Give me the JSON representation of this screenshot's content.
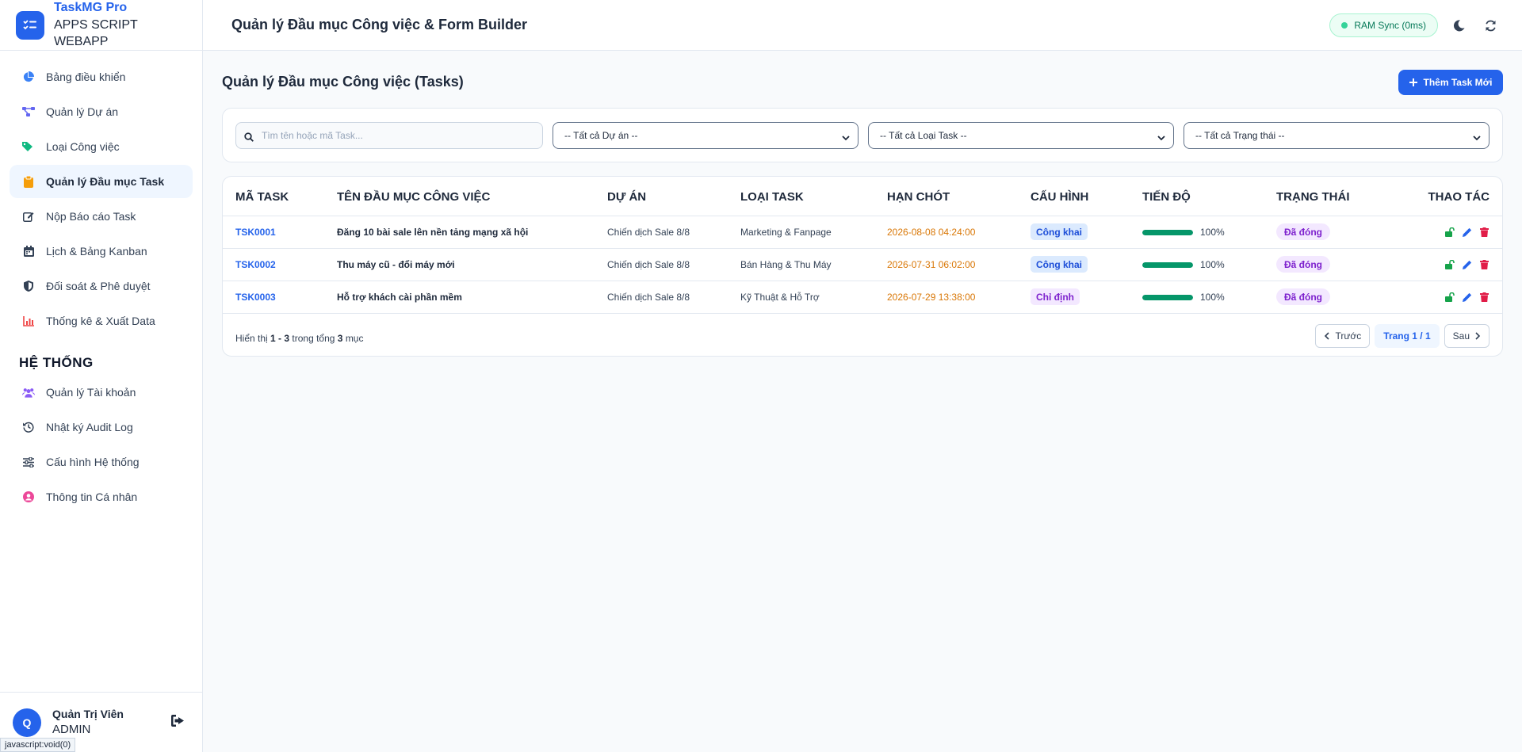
{
  "brand": {
    "name": "TaskMG Pro",
    "subtitle": "APPS SCRIPT WEBAPP"
  },
  "sidebar": {
    "items": [
      {
        "label": "Bảng điều khiển",
        "icon": "pie-chart-icon",
        "color": "#3b82f6",
        "active": false
      },
      {
        "label": "Quản lý Dự án",
        "icon": "project-diagram-icon",
        "color": "#6366f1",
        "active": false
      },
      {
        "label": "Loại Công việc",
        "icon": "tags-icon",
        "color": "#10b981",
        "active": false
      },
      {
        "label": "Quản lý Đầu mục Task",
        "icon": "clipboard-icon",
        "color": "#f59e0b",
        "active": true
      },
      {
        "label": "Nộp Báo cáo Task",
        "icon": "edit-icon",
        "color": "#334155",
        "active": false
      },
      {
        "label": "Lịch & Bảng Kanban",
        "icon": "calendar-icon",
        "color": "#334155",
        "active": false
      },
      {
        "label": "Đối soát & Phê duyệt",
        "icon": "shield-icon",
        "color": "#334155",
        "active": false
      },
      {
        "label": "Thống kê & Xuất Data",
        "icon": "bar-chart-icon",
        "color": "#ef4444",
        "active": false
      }
    ],
    "system_section": "HỆ THỐNG",
    "system_items": [
      {
        "label": "Quản lý Tài khoản",
        "icon": "users-icon",
        "color": "#8b5cf6"
      },
      {
        "label": "Nhật ký Audit Log",
        "icon": "history-icon",
        "color": "#334155"
      },
      {
        "label": "Cấu hình Hệ thống",
        "icon": "sliders-icon",
        "color": "#334155"
      },
      {
        "label": "Thông tin Cá nhân",
        "icon": "user-circle-icon",
        "color": "#ec4899"
      }
    ]
  },
  "user": {
    "initial": "Q",
    "name": "Quản Trị Viên",
    "role": "ADMIN"
  },
  "status_url": "javascript:void(0)",
  "header": {
    "title": "Quản lý Đầu mục Công việc & Form Builder",
    "ram_sync": "RAM Sync (0ms)"
  },
  "main": {
    "title": "Quản lý Đầu mục Công việc (Tasks)",
    "add_button": "Thêm Task Mới",
    "search_placeholder": "Tìm tên hoặc mã Task...",
    "filters": [
      "-- Tất cả Dự án --",
      "-- Tất cả Loại Task --",
      "-- Tất cả Trạng thái --"
    ]
  },
  "table": {
    "columns": [
      "MÃ TASK",
      "TÊN ĐẦU MỤC CÔNG VIỆC",
      "DỰ ÁN",
      "LOẠI TASK",
      "HẠN CHÓT",
      "CẤU HÌNH",
      "TIẾN ĐỘ",
      "TRẠNG THÁI",
      "THAO TÁC"
    ],
    "rows": [
      {
        "code": "TSK0001",
        "name": "Đăng 10 bài sale lên nền tảng mạng xã hội",
        "project": "Chiến dịch Sale 8/8",
        "type": "Marketing & Fanpage",
        "deadline": "2026-08-08 04:24:00",
        "config": "Công khai",
        "config_kind": "public",
        "progress": 1.0,
        "progress_label": "100%",
        "status": "Đã đóng"
      },
      {
        "code": "TSK0002",
        "name": "Thu máy cũ - đổi máy mới",
        "project": "Chiến dịch Sale 8/8",
        "type": "Bán Hàng & Thu Máy",
        "deadline": "2026-07-31 06:02:00",
        "config": "Công khai",
        "config_kind": "public",
        "progress": 1.0,
        "progress_label": "100%",
        "status": "Đã đóng"
      },
      {
        "code": "TSK0003",
        "name": "Hỗ trợ khách cài phần mềm",
        "project": "Chiến dịch Sale 8/8",
        "type": "Kỹ Thuật & Hỗ Trợ",
        "deadline": "2026-07-29 13:38:00",
        "config": "Chỉ định",
        "config_kind": "assigned",
        "progress": 1.0,
        "progress_label": "100%",
        "status": "Đã đóng"
      }
    ]
  },
  "pagination": {
    "info_prefix": "Hiển thị",
    "info_range": "1 - 3",
    "info_mid": "trong tổng",
    "info_total": "3",
    "info_suffix": "mục",
    "prev": "Trước",
    "current": "Trang 1 / 1",
    "next": "Sau"
  }
}
